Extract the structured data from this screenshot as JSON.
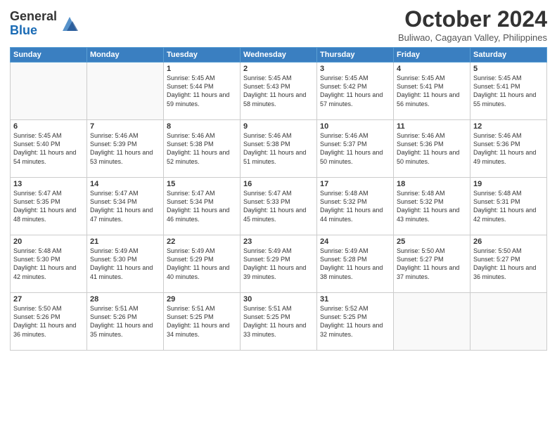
{
  "header": {
    "logo_general": "General",
    "logo_blue": "Blue",
    "month_title": "October 2024",
    "location": "Buliwao, Cagayan Valley, Philippines"
  },
  "days_of_week": [
    "Sunday",
    "Monday",
    "Tuesday",
    "Wednesday",
    "Thursday",
    "Friday",
    "Saturday"
  ],
  "weeks": [
    [
      {
        "day": "",
        "info": ""
      },
      {
        "day": "",
        "info": ""
      },
      {
        "day": "1",
        "info": "Sunrise: 5:45 AM\nSunset: 5:44 PM\nDaylight: 11 hours and 59 minutes."
      },
      {
        "day": "2",
        "info": "Sunrise: 5:45 AM\nSunset: 5:43 PM\nDaylight: 11 hours and 58 minutes."
      },
      {
        "day": "3",
        "info": "Sunrise: 5:45 AM\nSunset: 5:42 PM\nDaylight: 11 hours and 57 minutes."
      },
      {
        "day": "4",
        "info": "Sunrise: 5:45 AM\nSunset: 5:41 PM\nDaylight: 11 hours and 56 minutes."
      },
      {
        "day": "5",
        "info": "Sunrise: 5:45 AM\nSunset: 5:41 PM\nDaylight: 11 hours and 55 minutes."
      }
    ],
    [
      {
        "day": "6",
        "info": "Sunrise: 5:45 AM\nSunset: 5:40 PM\nDaylight: 11 hours and 54 minutes."
      },
      {
        "day": "7",
        "info": "Sunrise: 5:46 AM\nSunset: 5:39 PM\nDaylight: 11 hours and 53 minutes."
      },
      {
        "day": "8",
        "info": "Sunrise: 5:46 AM\nSunset: 5:38 PM\nDaylight: 11 hours and 52 minutes."
      },
      {
        "day": "9",
        "info": "Sunrise: 5:46 AM\nSunset: 5:38 PM\nDaylight: 11 hours and 51 minutes."
      },
      {
        "day": "10",
        "info": "Sunrise: 5:46 AM\nSunset: 5:37 PM\nDaylight: 11 hours and 50 minutes."
      },
      {
        "day": "11",
        "info": "Sunrise: 5:46 AM\nSunset: 5:36 PM\nDaylight: 11 hours and 50 minutes."
      },
      {
        "day": "12",
        "info": "Sunrise: 5:46 AM\nSunset: 5:36 PM\nDaylight: 11 hours and 49 minutes."
      }
    ],
    [
      {
        "day": "13",
        "info": "Sunrise: 5:47 AM\nSunset: 5:35 PM\nDaylight: 11 hours and 48 minutes."
      },
      {
        "day": "14",
        "info": "Sunrise: 5:47 AM\nSunset: 5:34 PM\nDaylight: 11 hours and 47 minutes."
      },
      {
        "day": "15",
        "info": "Sunrise: 5:47 AM\nSunset: 5:34 PM\nDaylight: 11 hours and 46 minutes."
      },
      {
        "day": "16",
        "info": "Sunrise: 5:47 AM\nSunset: 5:33 PM\nDaylight: 11 hours and 45 minutes."
      },
      {
        "day": "17",
        "info": "Sunrise: 5:48 AM\nSunset: 5:32 PM\nDaylight: 11 hours and 44 minutes."
      },
      {
        "day": "18",
        "info": "Sunrise: 5:48 AM\nSunset: 5:32 PM\nDaylight: 11 hours and 43 minutes."
      },
      {
        "day": "19",
        "info": "Sunrise: 5:48 AM\nSunset: 5:31 PM\nDaylight: 11 hours and 42 minutes."
      }
    ],
    [
      {
        "day": "20",
        "info": "Sunrise: 5:48 AM\nSunset: 5:30 PM\nDaylight: 11 hours and 42 minutes."
      },
      {
        "day": "21",
        "info": "Sunrise: 5:49 AM\nSunset: 5:30 PM\nDaylight: 11 hours and 41 minutes."
      },
      {
        "day": "22",
        "info": "Sunrise: 5:49 AM\nSunset: 5:29 PM\nDaylight: 11 hours and 40 minutes."
      },
      {
        "day": "23",
        "info": "Sunrise: 5:49 AM\nSunset: 5:29 PM\nDaylight: 11 hours and 39 minutes."
      },
      {
        "day": "24",
        "info": "Sunrise: 5:49 AM\nSunset: 5:28 PM\nDaylight: 11 hours and 38 minutes."
      },
      {
        "day": "25",
        "info": "Sunrise: 5:50 AM\nSunset: 5:27 PM\nDaylight: 11 hours and 37 minutes."
      },
      {
        "day": "26",
        "info": "Sunrise: 5:50 AM\nSunset: 5:27 PM\nDaylight: 11 hours and 36 minutes."
      }
    ],
    [
      {
        "day": "27",
        "info": "Sunrise: 5:50 AM\nSunset: 5:26 PM\nDaylight: 11 hours and 36 minutes."
      },
      {
        "day": "28",
        "info": "Sunrise: 5:51 AM\nSunset: 5:26 PM\nDaylight: 11 hours and 35 minutes."
      },
      {
        "day": "29",
        "info": "Sunrise: 5:51 AM\nSunset: 5:25 PM\nDaylight: 11 hours and 34 minutes."
      },
      {
        "day": "30",
        "info": "Sunrise: 5:51 AM\nSunset: 5:25 PM\nDaylight: 11 hours and 33 minutes."
      },
      {
        "day": "31",
        "info": "Sunrise: 5:52 AM\nSunset: 5:25 PM\nDaylight: 11 hours and 32 minutes."
      },
      {
        "day": "",
        "info": ""
      },
      {
        "day": "",
        "info": ""
      }
    ]
  ]
}
